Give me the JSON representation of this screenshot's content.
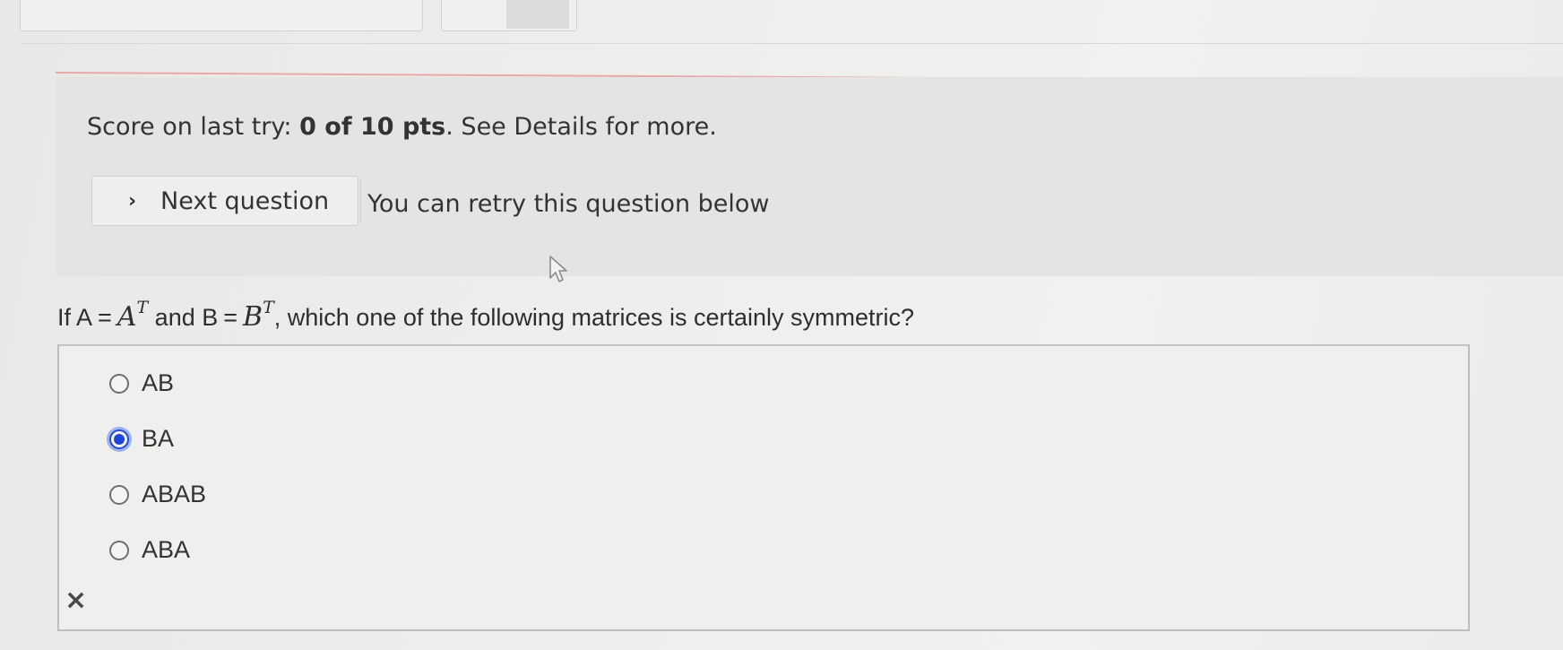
{
  "feedback": {
    "score_prefix": "Score on last try: ",
    "score_value": "0 of 10 pts",
    "score_suffix": ". See Details for more.",
    "next_button_label": "Next question",
    "retry_text": "You can retry this question below"
  },
  "question": {
    "prefix": "If ",
    "a_var": "A",
    "eq": "=",
    "a_math": "A",
    "transpose": "T",
    "and": " and ",
    "b_var": "B",
    "b_math": "B",
    "suffix": ", which one of the following matrices is certainly symmetric?"
  },
  "options": [
    {
      "label": "AB",
      "selected": false
    },
    {
      "label": "BA",
      "selected": true
    },
    {
      "label": "ABAB",
      "selected": false
    },
    {
      "label": "ABA",
      "selected": false
    }
  ],
  "result_mark": "×",
  "colors": {
    "selected_radio": "#1f44d6",
    "accent_rule": "#e7a9a9"
  }
}
